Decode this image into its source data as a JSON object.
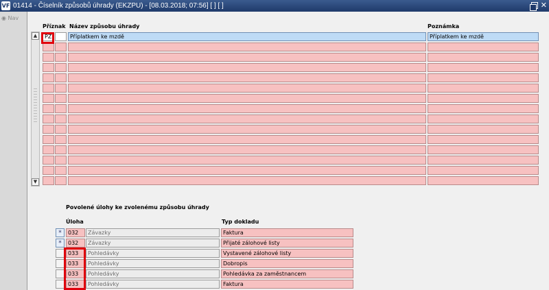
{
  "window": {
    "title": "01414 - Číselník způsobů úhrady (EKZPU) - [08.03.2018; 07:56]  [ ]  [ ]",
    "app_icon": "VF"
  },
  "sidebar": {
    "nav_label": "Nav"
  },
  "top_grid": {
    "headers": {
      "flag": "Příznak",
      "name": "Název způsobu úhrady",
      "note": "Poznámka"
    },
    "rows": [
      {
        "flag": "PZ",
        "name": "Příplatkem ke mzdě",
        "note": "Příplatkem ke mzdě"
      },
      {
        "flag": "",
        "name": "",
        "note": ""
      },
      {
        "flag": "",
        "name": "",
        "note": ""
      },
      {
        "flag": "",
        "name": "",
        "note": ""
      },
      {
        "flag": "",
        "name": "",
        "note": ""
      },
      {
        "flag": "",
        "name": "",
        "note": ""
      },
      {
        "flag": "",
        "name": "",
        "note": ""
      },
      {
        "flag": "",
        "name": "",
        "note": ""
      },
      {
        "flag": "",
        "name": "",
        "note": ""
      },
      {
        "flag": "",
        "name": "",
        "note": ""
      },
      {
        "flag": "",
        "name": "",
        "note": ""
      },
      {
        "flag": "",
        "name": "",
        "note": ""
      },
      {
        "flag": "",
        "name": "",
        "note": ""
      },
      {
        "flag": "",
        "name": "",
        "note": ""
      },
      {
        "flag": "",
        "name": "",
        "note": ""
      }
    ]
  },
  "bottom_grid": {
    "section_title": "Povolené úlohy ke zvolenému způsobu úhrady",
    "headers": {
      "task": "Úloha",
      "doc_type": "Typ dokladu"
    },
    "rows": [
      {
        "marker": "*",
        "code": "032",
        "task_name": "Závazky",
        "doc_type": "Faktura"
      },
      {
        "marker": "*",
        "code": "032",
        "task_name": "Závazky",
        "doc_type": "Přijaté zálohové listy"
      },
      {
        "marker": "",
        "code": "033",
        "task_name": "Pohledávky",
        "doc_type": "Vystavené zálohové listy"
      },
      {
        "marker": "",
        "code": "033",
        "task_name": "Pohledávky",
        "doc_type": "Dobropis"
      },
      {
        "marker": "",
        "code": "033",
        "task_name": "Pohledávky",
        "doc_type": "Pohledávka za zaměstnancem"
      },
      {
        "marker": "",
        "code": "033",
        "task_name": "Pohledávky",
        "doc_type": "Faktura"
      }
    ]
  },
  "colors": {
    "title_bar": "#1f3a6b",
    "row_pink": "#f7c1c1",
    "row_selected": "#bedbf6",
    "highlight_red": "#e0000c"
  },
  "icons": [
    "app-icon",
    "restore-icon",
    "close-icon",
    "nav-icon",
    "scroll-up-icon",
    "scroll-down-icon"
  ]
}
